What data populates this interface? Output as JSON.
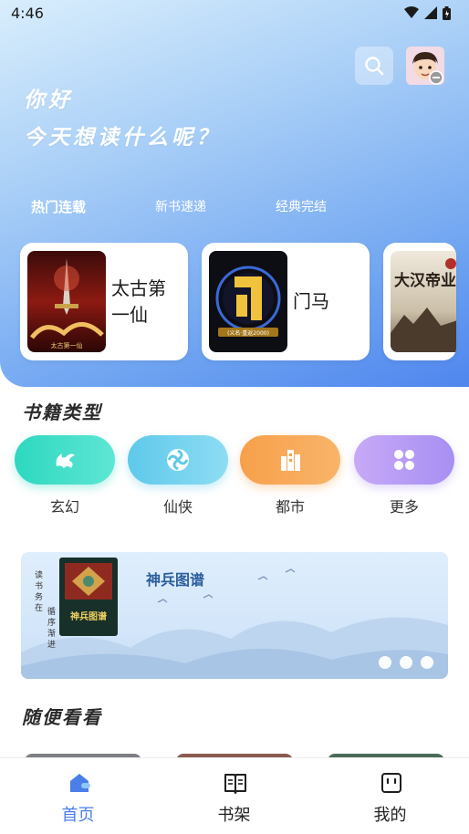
{
  "status_bar": {
    "time": "4:46",
    "icons": [
      "wifi-icon",
      "signal-icon",
      "battery-icon"
    ]
  },
  "header": {
    "greeting_line1": "你好",
    "greeting_line2": "今天想读什么呢？",
    "search_icon": "search-icon",
    "avatar": "user-avatar"
  },
  "tabs": [
    {
      "label": "热门连载",
      "active": true
    },
    {
      "label": "新书速递",
      "active": false
    },
    {
      "label": "经典完结",
      "active": false
    }
  ],
  "featured_books": [
    {
      "title": "太古第一仙",
      "cover_text": "太古第一仙"
    },
    {
      "title": "门马",
      "cover_text": "(义名·重返2000)"
    },
    {
      "title": "",
      "cover_text": "大汉帝业"
    }
  ],
  "categories_section": {
    "title": "书籍类型",
    "items": [
      {
        "label": "玄幻",
        "icon": "dragon-icon",
        "color": "#36d6c2"
      },
      {
        "label": "仙侠",
        "icon": "swirl-icon",
        "color": "#5fcde9"
      },
      {
        "label": "都市",
        "icon": "city-icon",
        "color": "#f59b45"
      },
      {
        "label": "更多",
        "icon": "grid-icon",
        "color": "#a88cf4"
      }
    ]
  },
  "banner": {
    "title": "神兵图谱",
    "cover_text": "神兵图谱",
    "side_text_1": "读书务在",
    "side_text_2": "循序渐进",
    "page_count": 3
  },
  "browse_section": {
    "title": "随便看看"
  },
  "bottom_nav": [
    {
      "label": "首页",
      "icon": "home-icon",
      "active": true
    },
    {
      "label": "书架",
      "icon": "book-icon",
      "active": false
    },
    {
      "label": "我的",
      "icon": "profile-icon",
      "active": false
    }
  ],
  "colors": {
    "accent": "#4a7ee8",
    "hero_start": "#d9eefc",
    "hero_end": "#4f86ee"
  }
}
